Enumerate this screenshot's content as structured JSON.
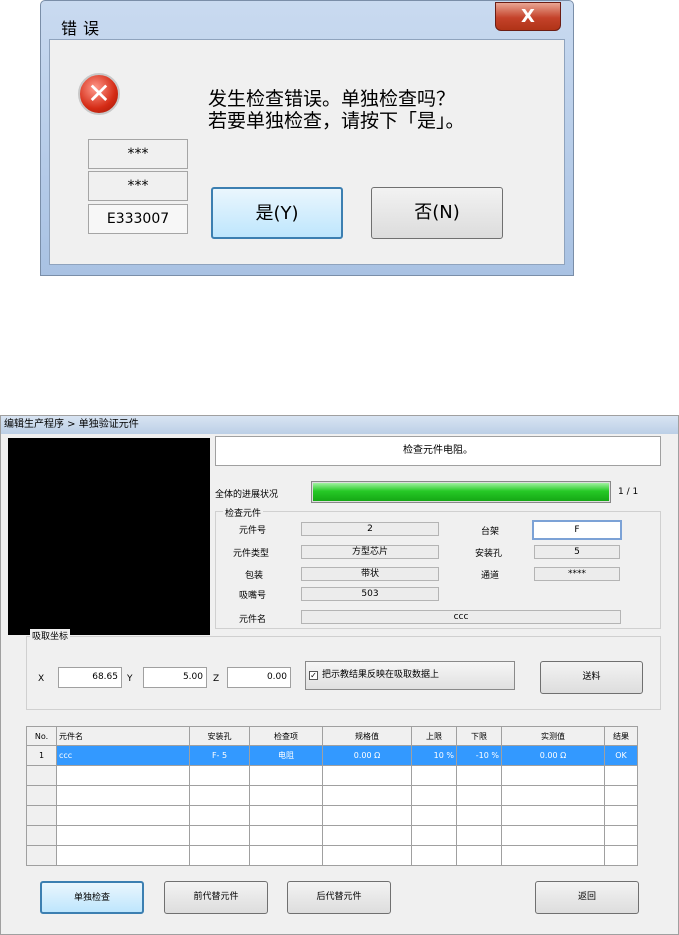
{
  "dialog": {
    "title": "错误",
    "close_label": "X",
    "message_line1": "发生检查错误。单独检查吗？",
    "message_line2": "若要单独检查，请按下「是」。",
    "codes": [
      "***",
      "***",
      "E333007"
    ],
    "yes_label": "是(Y)",
    "no_label": "否(N)"
  },
  "window": {
    "title": "编辑生产程序 > 单独验证元件",
    "instruction": "检查元件电阻。",
    "progress_label": "全体的进展状况",
    "progress_value": 1.0,
    "progress_text": "1 / 1",
    "inspect_group": "检查元件",
    "fields": {
      "part_no_label": "元件号",
      "part_no": "2",
      "part_type_label": "元件类型",
      "part_type": "方型芯片",
      "package_label": "包装",
      "package": "带状",
      "nozzle_label": "吸嘴号",
      "nozzle": "503",
      "part_name_label": "元件名",
      "part_name": "ccc",
      "rack_label": "台架",
      "rack": "F",
      "hole_label": "安装孔",
      "hole": "5",
      "channel_label": "通道",
      "channel": "****"
    },
    "pickup_group": "吸取坐标",
    "coords": {
      "x_label": "X",
      "x": "68.65",
      "y_label": "Y",
      "y": "5.00",
      "z_label": "Z",
      "z": "0.00"
    },
    "reflect_checkbox": "把示教结果反映在吸取数据上",
    "reflect_checked": "✓",
    "feed_button": "送料",
    "table": {
      "headers": [
        "No.",
        "元件名",
        "安装孔",
        "检查项",
        "规格值",
        "上限",
        "下限",
        "实测值",
        "结果"
      ],
      "rows": [
        [
          "1",
          "ccc",
          "F- 5",
          "电阻",
          "0.00 Ω",
          "10 %",
          "-10 %",
          "0.00 Ω",
          "OK"
        ]
      ]
    },
    "buttons": {
      "single_check": "单独检查",
      "prev_alt": "前代替元件",
      "next_alt": "后代替元件",
      "back": "返回"
    }
  }
}
